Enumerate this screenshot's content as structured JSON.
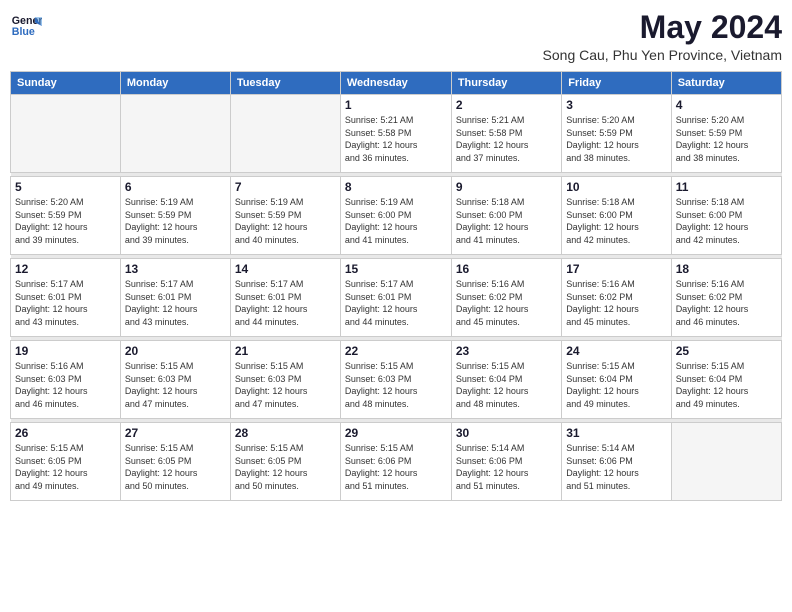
{
  "logo": {
    "line1": "General",
    "line2": "Blue"
  },
  "title": "May 2024",
  "subtitle": "Song Cau, Phu Yen Province, Vietnam",
  "headers": [
    "Sunday",
    "Monday",
    "Tuesday",
    "Wednesday",
    "Thursday",
    "Friday",
    "Saturday"
  ],
  "weeks": [
    [
      {
        "day": "",
        "info": ""
      },
      {
        "day": "",
        "info": ""
      },
      {
        "day": "",
        "info": ""
      },
      {
        "day": "1",
        "info": "Sunrise: 5:21 AM\nSunset: 5:58 PM\nDaylight: 12 hours\nand 36 minutes."
      },
      {
        "day": "2",
        "info": "Sunrise: 5:21 AM\nSunset: 5:58 PM\nDaylight: 12 hours\nand 37 minutes."
      },
      {
        "day": "3",
        "info": "Sunrise: 5:20 AM\nSunset: 5:59 PM\nDaylight: 12 hours\nand 38 minutes."
      },
      {
        "day": "4",
        "info": "Sunrise: 5:20 AM\nSunset: 5:59 PM\nDaylight: 12 hours\nand 38 minutes."
      }
    ],
    [
      {
        "day": "5",
        "info": "Sunrise: 5:20 AM\nSunset: 5:59 PM\nDaylight: 12 hours\nand 39 minutes."
      },
      {
        "day": "6",
        "info": "Sunrise: 5:19 AM\nSunset: 5:59 PM\nDaylight: 12 hours\nand 39 minutes."
      },
      {
        "day": "7",
        "info": "Sunrise: 5:19 AM\nSunset: 5:59 PM\nDaylight: 12 hours\nand 40 minutes."
      },
      {
        "day": "8",
        "info": "Sunrise: 5:19 AM\nSunset: 6:00 PM\nDaylight: 12 hours\nand 41 minutes."
      },
      {
        "day": "9",
        "info": "Sunrise: 5:18 AM\nSunset: 6:00 PM\nDaylight: 12 hours\nand 41 minutes."
      },
      {
        "day": "10",
        "info": "Sunrise: 5:18 AM\nSunset: 6:00 PM\nDaylight: 12 hours\nand 42 minutes."
      },
      {
        "day": "11",
        "info": "Sunrise: 5:18 AM\nSunset: 6:00 PM\nDaylight: 12 hours\nand 42 minutes."
      }
    ],
    [
      {
        "day": "12",
        "info": "Sunrise: 5:17 AM\nSunset: 6:01 PM\nDaylight: 12 hours\nand 43 minutes."
      },
      {
        "day": "13",
        "info": "Sunrise: 5:17 AM\nSunset: 6:01 PM\nDaylight: 12 hours\nand 43 minutes."
      },
      {
        "day": "14",
        "info": "Sunrise: 5:17 AM\nSunset: 6:01 PM\nDaylight: 12 hours\nand 44 minutes."
      },
      {
        "day": "15",
        "info": "Sunrise: 5:17 AM\nSunset: 6:01 PM\nDaylight: 12 hours\nand 44 minutes."
      },
      {
        "day": "16",
        "info": "Sunrise: 5:16 AM\nSunset: 6:02 PM\nDaylight: 12 hours\nand 45 minutes."
      },
      {
        "day": "17",
        "info": "Sunrise: 5:16 AM\nSunset: 6:02 PM\nDaylight: 12 hours\nand 45 minutes."
      },
      {
        "day": "18",
        "info": "Sunrise: 5:16 AM\nSunset: 6:02 PM\nDaylight: 12 hours\nand 46 minutes."
      }
    ],
    [
      {
        "day": "19",
        "info": "Sunrise: 5:16 AM\nSunset: 6:03 PM\nDaylight: 12 hours\nand 46 minutes."
      },
      {
        "day": "20",
        "info": "Sunrise: 5:15 AM\nSunset: 6:03 PM\nDaylight: 12 hours\nand 47 minutes."
      },
      {
        "day": "21",
        "info": "Sunrise: 5:15 AM\nSunset: 6:03 PM\nDaylight: 12 hours\nand 47 minutes."
      },
      {
        "day": "22",
        "info": "Sunrise: 5:15 AM\nSunset: 6:03 PM\nDaylight: 12 hours\nand 48 minutes."
      },
      {
        "day": "23",
        "info": "Sunrise: 5:15 AM\nSunset: 6:04 PM\nDaylight: 12 hours\nand 48 minutes."
      },
      {
        "day": "24",
        "info": "Sunrise: 5:15 AM\nSunset: 6:04 PM\nDaylight: 12 hours\nand 49 minutes."
      },
      {
        "day": "25",
        "info": "Sunrise: 5:15 AM\nSunset: 6:04 PM\nDaylight: 12 hours\nand 49 minutes."
      }
    ],
    [
      {
        "day": "26",
        "info": "Sunrise: 5:15 AM\nSunset: 6:05 PM\nDaylight: 12 hours\nand 49 minutes."
      },
      {
        "day": "27",
        "info": "Sunrise: 5:15 AM\nSunset: 6:05 PM\nDaylight: 12 hours\nand 50 minutes."
      },
      {
        "day": "28",
        "info": "Sunrise: 5:15 AM\nSunset: 6:05 PM\nDaylight: 12 hours\nand 50 minutes."
      },
      {
        "day": "29",
        "info": "Sunrise: 5:15 AM\nSunset: 6:06 PM\nDaylight: 12 hours\nand 51 minutes."
      },
      {
        "day": "30",
        "info": "Sunrise: 5:14 AM\nSunset: 6:06 PM\nDaylight: 12 hours\nand 51 minutes."
      },
      {
        "day": "31",
        "info": "Sunrise: 5:14 AM\nSunset: 6:06 PM\nDaylight: 12 hours\nand 51 minutes."
      },
      {
        "day": "",
        "info": ""
      }
    ]
  ]
}
